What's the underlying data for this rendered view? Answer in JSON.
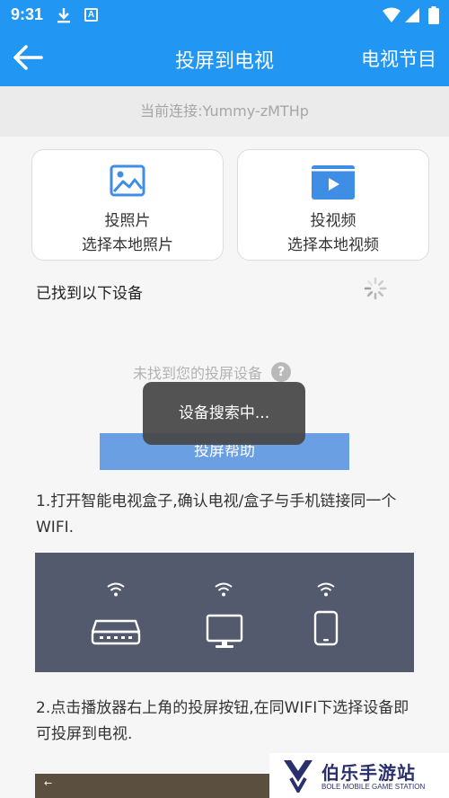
{
  "status_bar": {
    "time": "9:31",
    "icons": [
      "download-icon",
      "a-notification-icon",
      "wifi-icon",
      "signal-icon",
      "battery-icon"
    ]
  },
  "app_bar": {
    "title": "投屏到电视",
    "action": "电视节目",
    "back_icon": "arrow-left-icon",
    "color": "#2196f3"
  },
  "connection": {
    "text": "当前连接:Yummy-zMTHp"
  },
  "cards": {
    "photo": {
      "title": "投照片",
      "subtitle": "选择本地照片",
      "icon": "image-icon"
    },
    "video": {
      "title": "投视频",
      "subtitle": "选择本地视频",
      "icon": "video-play-icon"
    }
  },
  "devices": {
    "found_label": "已找到以下设备",
    "not_found": "未找到您的投屏设备",
    "help_icon_text": "?"
  },
  "help_button": {
    "label": "投屏帮助"
  },
  "toast": {
    "text": "设备搜索中..."
  },
  "help_steps": {
    "step1": "1.打开智能电视盒子,确认电视/盒子与手机链接同一个WIFI.",
    "step2": "2.点击播放器右上角的投屏按钮,在同WIFI下选择设备即可投屏到电视."
  },
  "illustration": {
    "items": [
      "tv-box-icon",
      "monitor-icon",
      "phone-icon"
    ]
  },
  "watermark": {
    "cn": "伯乐手游站",
    "en": "BOLE MOBILE GAME STATION"
  }
}
